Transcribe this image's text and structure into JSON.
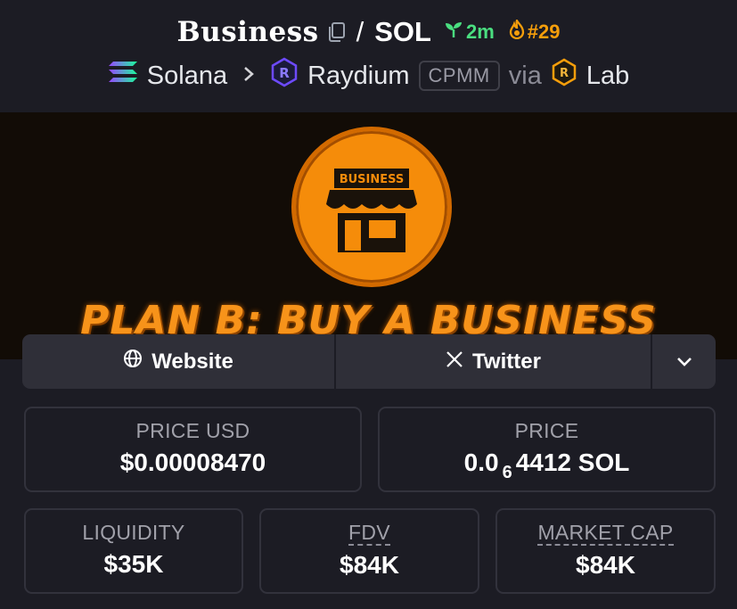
{
  "header": {
    "base_token": "Business",
    "separator": "/",
    "quote_token": "SOL",
    "age": "2m",
    "rank": "#29",
    "chain": "Solana",
    "dex": "Raydium",
    "pool_type": "CPMM",
    "via_label": "via",
    "launchpad": "Lab"
  },
  "banner": {
    "sign_text": "BUSINESS",
    "tagline": "PLAN B: BUY A BUSINESS"
  },
  "links": {
    "website_label": "Website",
    "twitter_label": "Twitter"
  },
  "stats": {
    "price_usd": {
      "label": "PRICE USD",
      "value": "$0.00008470"
    },
    "price": {
      "label": "PRICE",
      "value_prefix": "0.0",
      "value_subscript": "6",
      "value_suffix": "4412 SOL"
    },
    "liquidity": {
      "label": "LIQUIDITY",
      "value": "$35K"
    },
    "fdv": {
      "label": "FDV",
      "value": "$84K"
    },
    "market_cap": {
      "label": "MARKET CAP",
      "value": "$84K"
    }
  },
  "colors": {
    "background": "#1c1c24",
    "age_green": "#4ade80",
    "rank_orange": "#f59e0b",
    "banner_orange": "#f58c0a",
    "raydium_purple": "#6d4aff"
  },
  "icons": {
    "copy": "copy-icon",
    "age": "seedling-icon",
    "rank": "flame-icon",
    "chain": "solana-logo-icon",
    "dex": "raydium-logo-icon",
    "launchpad": "lab-logo-icon",
    "website": "globe-icon",
    "twitter": "x-icon",
    "more": "chevron-down-icon"
  }
}
